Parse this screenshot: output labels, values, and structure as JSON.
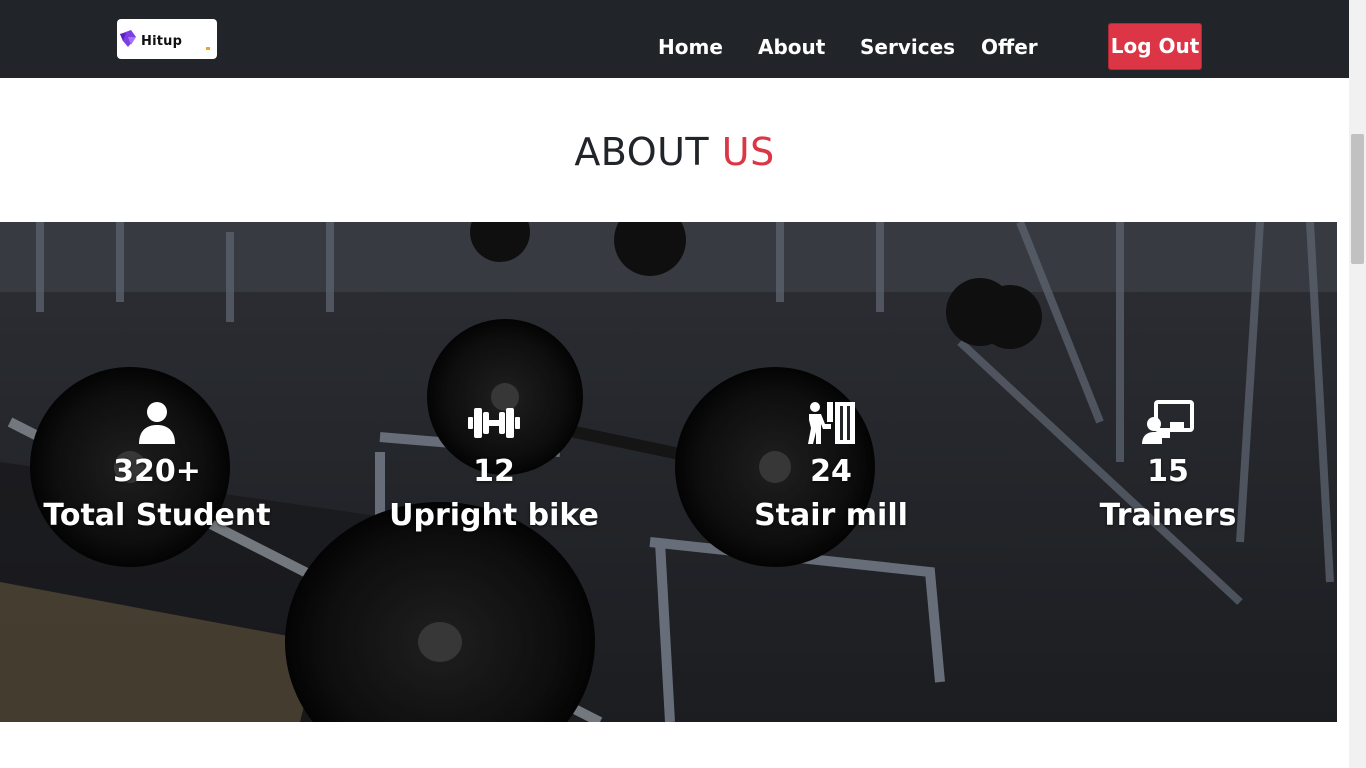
{
  "navbar": {
    "logo_text": "Hitup",
    "links": [
      {
        "label": "Home"
      },
      {
        "label": "About"
      },
      {
        "label": "Services"
      },
      {
        "label": "Offer"
      }
    ],
    "logout_label": "Log Out"
  },
  "about": {
    "title_main": "ABOUT",
    "title_accent": "US"
  },
  "stats": [
    {
      "icon": "user-icon",
      "value": "320+",
      "label": "Total Student"
    },
    {
      "icon": "dumbbell-icon",
      "value": "12",
      "label": "Upright bike"
    },
    {
      "icon": "person-booth-icon",
      "value": "24",
      "label": "Stair mill"
    },
    {
      "icon": "chalkboard-teacher-icon",
      "value": "15",
      "label": "Trainers"
    }
  ],
  "colors": {
    "navbar_bg": "#212529",
    "accent": "#dc3545",
    "text_dark": "#212529",
    "text_light": "#ffffff"
  }
}
